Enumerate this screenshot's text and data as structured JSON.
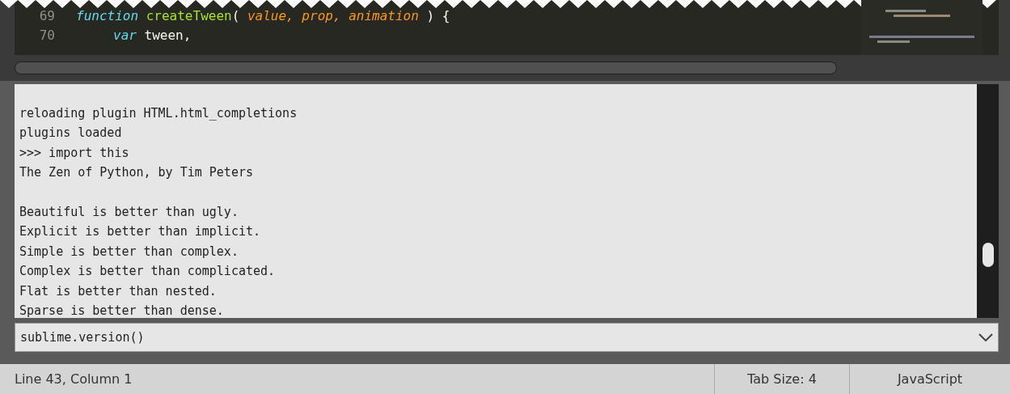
{
  "editor": {
    "lines": [
      {
        "number": "69",
        "indent": false,
        "tokens": [
          {
            "text": "function ",
            "kind": "keyword"
          },
          {
            "text": "createTween",
            "kind": "name"
          },
          {
            "text": "( ",
            "kind": "plain"
          },
          {
            "text": "value, prop, animation",
            "kind": "param"
          },
          {
            "text": " ) {",
            "kind": "plain"
          }
        ]
      },
      {
        "number": "70",
        "indent": true,
        "tokens": [
          {
            "text": "var",
            "kind": "keyword"
          },
          {
            "text": " tween,",
            "kind": "plain"
          }
        ]
      }
    ]
  },
  "console": {
    "blocks": [
      [
        "reloading plugin HTML.html_completions",
        "plugins loaded",
        ">>> import this",
        "The Zen of Python, by Tim Peters"
      ],
      [
        "Beautiful is better than ugly.",
        "Explicit is better than implicit.",
        "Simple is better than complex.",
        "Complex is better than complicated.",
        "Flat is better than nested.",
        "Sparse is better than dense."
      ]
    ]
  },
  "input": {
    "value": "sublime.version()"
  },
  "status_bar": {
    "position": "Line 43, Column 1",
    "tab_size": "Tab Size: 4",
    "syntax": "JavaScript"
  }
}
